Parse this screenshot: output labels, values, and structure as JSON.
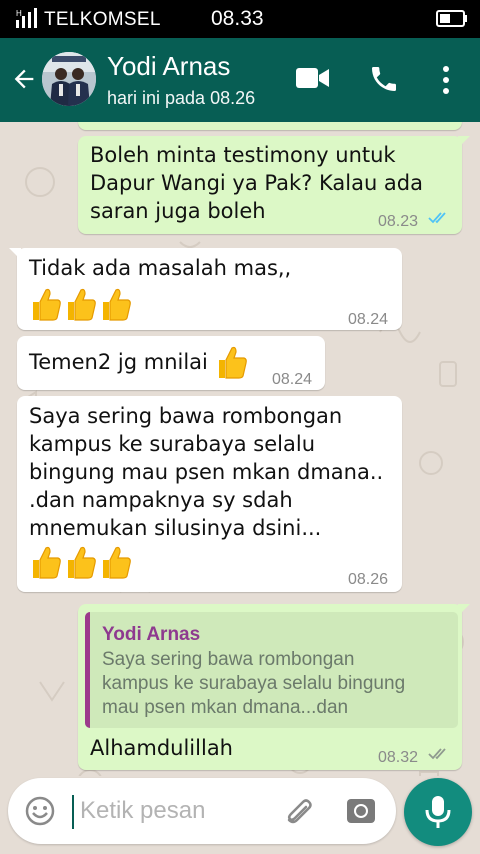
{
  "status_bar": {
    "signal_label": "H",
    "carrier": "TELKOMSEL",
    "time": "08.33"
  },
  "header": {
    "contact_name": "Yodi Arnas",
    "last_seen": "hari ini pada 08.26"
  },
  "messages": [
    {
      "direction": "out",
      "text": "Boleh minta testimony untuk\nDapur Wangi ya Pak? Kalau ada\nsaran juga boleh",
      "time": "08.23",
      "status": "read"
    },
    {
      "direction": "in",
      "text": "Tidak ada masalah mas,,",
      "emojis": [
        "thumbs-up",
        "thumbs-up",
        "thumbs-up"
      ],
      "time": "08.24"
    },
    {
      "direction": "in",
      "text": "Temen2 jg mnilai",
      "emojis": [
        "thumbs-up"
      ],
      "time": "08.24"
    },
    {
      "direction": "in",
      "text": "Saya sering bawa rombongan\nkampus ke surabaya selalu\nbingung mau psen mkan dmana..\n.dan nampaknya sy sdah\nmnemukan silusinya dsini...",
      "emojis": [
        "thumbs-up",
        "thumbs-up",
        "thumbs-up"
      ],
      "time": "08.26"
    },
    {
      "direction": "out",
      "quote": {
        "author": "Yodi Arnas",
        "text": "Saya sering bawa rombongan\nkampus ke surabaya selalu bingung\nmau psen mkan dmana...dan"
      },
      "text": "Alhamdulillah",
      "time": "08.32",
      "status": "delivered"
    }
  ],
  "composer": {
    "placeholder": "Ketik pesan"
  },
  "colors": {
    "header": "#075e54",
    "outgoing_bubble": "#dcf8c6",
    "incoming_bubble": "#ffffff",
    "read_ticks": "#4fc3f7",
    "mic_button": "#128c7e",
    "quote_author": "#8e3a8f"
  }
}
